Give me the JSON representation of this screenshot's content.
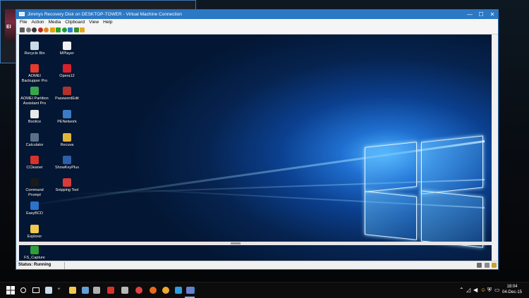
{
  "host": {
    "thumb_text": "EI"
  },
  "vm_window": {
    "title": "Jimmys Recovery Disk on DESKTOP-TOWER - Virtual Machine Connection",
    "controls": {
      "minimize": "—",
      "maximize": "☐",
      "close": "✕"
    },
    "menu": [
      "File",
      "Action",
      "Media",
      "Clipboard",
      "View",
      "Help"
    ],
    "toolbar_icons": [
      {
        "name": "ctrl-alt-del-icon",
        "color": "#5c5c5c",
        "shape": "sq"
      },
      {
        "name": "start-icon",
        "color": "#7a7a7a",
        "shape": "circle"
      },
      {
        "name": "turn-off-icon",
        "color": "#3c3c3c",
        "shape": "circle"
      },
      {
        "name": "shutdown-icon",
        "color": "#c42b1c",
        "shape": "circle"
      },
      {
        "name": "save-icon",
        "color": "#e2841b",
        "shape": "circle"
      },
      {
        "name": "pause-icon",
        "color": "#e7a10a",
        "shape": "sq"
      },
      {
        "name": "resume-icon",
        "color": "#2aa52a",
        "shape": "sq"
      },
      {
        "name": "reset-icon",
        "color": "#1f9d3f",
        "shape": "circle"
      },
      {
        "name": "checkpoint-icon",
        "color": "#2d7fd3",
        "shape": "sq"
      },
      {
        "name": "revert-icon",
        "color": "#3b8f2b",
        "shape": "sq"
      },
      {
        "name": "enhanced-session-icon",
        "color": "#e1a826",
        "shape": "sq"
      }
    ]
  },
  "guest_desktop": {
    "icons": [
      {
        "label": "Recycle Bin",
        "name": "recycle-bin-icon",
        "color": "#c9dbe9"
      },
      {
        "label": "AOMEI Backupper Pro",
        "name": "aomei-backupper-icon",
        "color": "#e23a2d"
      },
      {
        "label": "AOMEI Partition Assistant Pro",
        "name": "aomei-partition-icon",
        "color": "#3aa54d"
      },
      {
        "label": "Bootice",
        "name": "bootice-icon",
        "color": "#e8e8e8"
      },
      {
        "label": "Calculator",
        "name": "calculator-icon",
        "color": "#5a6f88"
      },
      {
        "label": "CCleaner",
        "name": "ccleaner-icon",
        "color": "#d8322d"
      },
      {
        "label": "Command Prompt",
        "name": "command-prompt-icon",
        "color": "#1a1a1a"
      },
      {
        "label": "EasyBCD",
        "name": "easybcd-icon",
        "color": "#2a73c9"
      },
      {
        "label": "Explorer",
        "name": "explorer-icon",
        "color": "#f2c94c"
      },
      {
        "label": "FS_Capture",
        "name": "fscapture-icon",
        "color": "#2e9d3a"
      },
      {
        "label": "MPlayer",
        "name": "mplayer-icon",
        "color": "#f0f0f0"
      },
      {
        "label": "Opera12",
        "name": "opera-icon",
        "color": "#d8202b"
      },
      {
        "label": "PasswordEdit",
        "name": "password-edit-icon",
        "color": "#b0322c"
      },
      {
        "label": "PENetwork",
        "name": "penetwork-icon",
        "color": "#3c7cc7"
      },
      {
        "label": "Recuva",
        "name": "recuva-icon",
        "color": "#e0b63a"
      },
      {
        "label": "ShowKeyPlus",
        "name": "showkeyplus-icon",
        "color": "#2c5fa8"
      },
      {
        "label": "Snipping Tool",
        "name": "snipping-tool-icon",
        "color": "#d93a3a"
      }
    ]
  },
  "status_bar": {
    "text": "Status: Running"
  },
  "taskbar": {
    "start": "start-icon",
    "items": [
      {
        "name": "search-icon",
        "color": "#ffffff"
      },
      {
        "name": "task-view-icon",
        "color": "#ffffff"
      },
      {
        "name": "recycle-bin-icon",
        "color": "#c9dbe9"
      },
      {
        "name": "quote-icon",
        "color": "#ffffff"
      },
      {
        "name": "file-explorer-icon",
        "color": "#f2c94c"
      },
      {
        "name": "hyperv-manager-icon",
        "color": "#5fa0d8"
      },
      {
        "name": "settings-icon",
        "color": "#b0b0b0"
      },
      {
        "name": "ccleaner-icon",
        "color": "#d8322d"
      },
      {
        "name": "media-icon",
        "color": "#b8b8b8"
      },
      {
        "name": "chrome-icon",
        "color": "#e0443e"
      },
      {
        "name": "firefox-icon",
        "color": "#e86a1e"
      },
      {
        "name": "chrome-canary-icon",
        "color": "#f0a92d"
      },
      {
        "name": "internet-explorer-icon",
        "color": "#2f9be1"
      },
      {
        "name": "edge-icon",
        "color": "#2b8fe3"
      },
      {
        "name": "vm-connection-icon",
        "color": "#6b7fd0"
      }
    ],
    "tray_icons": [
      "chevron-up-icon",
      "network-icon",
      "volume-icon",
      "smiley-icon",
      "security-icon",
      "keyboard-icon"
    ],
    "time": "18:04",
    "date": "04-Dec-15"
  }
}
